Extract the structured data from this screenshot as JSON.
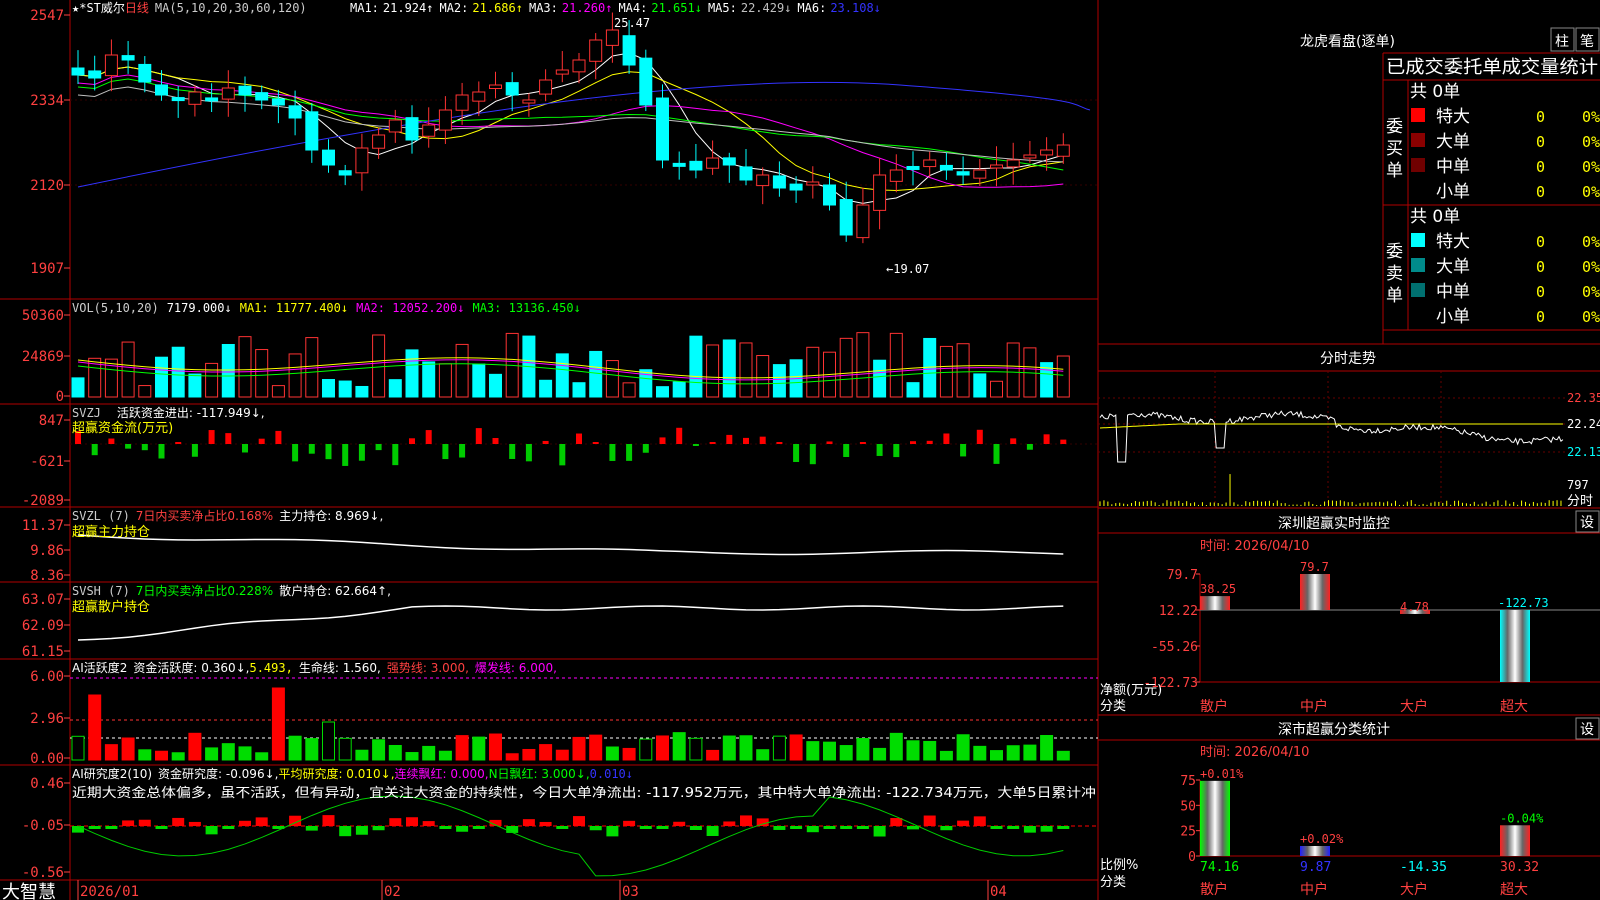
{
  "brand": "大智慧",
  "main_panel": {
    "stock_name": "★*ST威尔",
    "period": "日线",
    "ma_header": "MA(5,10,20,30,60,120)",
    "ma_values": [
      {
        "label": "MA1:",
        "value": "21.924↑",
        "color": "#ffffff"
      },
      {
        "label": "MA2:",
        "value": "21.686↑",
        "color": "#ffff00"
      },
      {
        "label": "MA3:",
        "value": "21.260↑",
        "color": "#ff00ff"
      },
      {
        "label": "MA4:",
        "value": "21.651↓",
        "color": "#00ff00"
      },
      {
        "label": "MA5:",
        "value": "22.429↓",
        "color": "#c0c0c0"
      },
      {
        "label": "MA6:",
        "value": "23.108↓",
        "color": "#3333ff"
      }
    ],
    "y_ticks": [
      "2547",
      "2334",
      "2120",
      "1907"
    ],
    "high_label": "25.47",
    "low_label": "←19.07"
  },
  "vol_panel": {
    "header": "VOL(5,10,20)",
    "value": "7179.000↓",
    "ma1": "MA1: 11777.400↓",
    "ma2": "MA2: 12052.200↓",
    "ma3": "MA3: 13136.450↓",
    "y_ticks": [
      "50360",
      "24869",
      "0"
    ]
  },
  "svzj_panel": {
    "header": "SVZJ",
    "line1": "活跃资金进出: -117.949↓,",
    "line2": "超赢资金流(万元)",
    "y_ticks": [
      "847",
      "-621",
      "-2089"
    ]
  },
  "svzl_panel": {
    "header": "SVZL (7)",
    "ratio": "7日内买卖净占比0.168%",
    "holding": "主力持仓: 8.969↓,",
    "line2": "超赢主力持仓",
    "y_ticks": [
      "11.37",
      "9.86",
      "8.36"
    ]
  },
  "svsh_panel": {
    "header": "SVSH (7)",
    "ratio": "7日内买卖净占比0.228%",
    "holding": "散户持仓: 62.664↑,",
    "line2": "超赢散户持仓",
    "y_ticks": [
      "63.07",
      "62.09",
      "61.15"
    ]
  },
  "ai_active_panel": {
    "header": "AI活跃度2",
    "activity": "资金活跃度: 0.360↓,",
    "value2": "5.493,",
    "life": "生命线: 1.560,",
    "strong": "强势线: 3.000,",
    "burst": "爆发线: 6.000,",
    "y_ticks": [
      "6.00",
      "2.96",
      "0.00"
    ]
  },
  "ai_research_panel": {
    "header": "AI研究度2(10)",
    "research": "资金研究度: -0.096↓,",
    "avg": "平均研究度: 0.010↓,",
    "red": "连续飘红: 0.000,",
    "nred": "N日飘红: 3.000↓,",
    "last": "0.010↓",
    "comment": "近期大资金总体偏多，虽不活跃，但有异动，宜关注大资金的持续性，今日大单净流出: -117.952万元，其中特大单净流出: -122.734万元，大单5日累计冲",
    "y_ticks": [
      "0.46",
      "-0.05",
      "-0.56"
    ]
  },
  "date_axis": [
    "2026/01",
    "02",
    "03",
    "04"
  ],
  "dragon_tiger": {
    "title": "龙虎看盘(逐单)",
    "btn1": "柱",
    "btn2": "笔",
    "subtitle": "已成交委托单成交量统计",
    "buy_side": {
      "side_label": "委买单",
      "total": "共 0单",
      "rows": [
        {
          "name": "特大",
          "count": "0",
          "pct": "0%",
          "color": "#ff0000"
        },
        {
          "name": "大单",
          "count": "0",
          "pct": "0%",
          "color": "#8b0000"
        },
        {
          "name": "中单",
          "count": "0",
          "pct": "0%",
          "color": "#700000"
        },
        {
          "name": "小单",
          "count": "0",
          "pct": "0%",
          "color": ""
        }
      ]
    },
    "sell_side": {
      "side_label": "委卖单",
      "total": "共 0单",
      "rows": [
        {
          "name": "特大",
          "count": "0",
          "pct": "0%",
          "color": "#00ffff"
        },
        {
          "name": "大单",
          "count": "0",
          "pct": "0%",
          "color": "#008b8b"
        },
        {
          "name": "中单",
          "count": "0",
          "pct": "0%",
          "color": "#007070"
        },
        {
          "name": "小单",
          "count": "0",
          "pct": "0%",
          "color": ""
        }
      ]
    }
  },
  "intraday": {
    "title": "分时走势",
    "y_labels": [
      "22.35",
      "22.24",
      "22.13"
    ],
    "vol_label": "797",
    "vol_unit": "分时"
  },
  "sz_monitor": {
    "title": "深圳超赢实时监控",
    "settings": "设",
    "time": "时间: 2026/04/10",
    "y_ticks": [
      "79.7",
      "12.22",
      "-55.26",
      "-122.73"
    ],
    "y_label": "净额(万元)",
    "x_label": "分类",
    "categories": [
      "散户",
      "中户",
      "大户",
      "超大"
    ],
    "values": [
      38.25,
      79.7,
      4.78,
      -122.73
    ],
    "value_labels": [
      "38.25",
      "79.7",
      "4.78",
      "-122.73"
    ]
  },
  "sz_class": {
    "title": "深市超赢分类统计",
    "settings": "设",
    "time": "时间: 2026/04/10",
    "y_ticks": [
      "75",
      "50",
      "25",
      "0"
    ],
    "y_label": "比例%",
    "x_label": "分类",
    "categories": [
      "散户",
      "中户",
      "大户",
      "超大"
    ],
    "values": [
      74.16,
      9.87,
      -14.35,
      30.32
    ],
    "value_labels": [
      "74.16",
      "9.87",
      "-14.35",
      "30.32"
    ],
    "change_labels": [
      "+0.01%",
      "+0.02%",
      "",
      "-0.04%"
    ]
  },
  "colors": {
    "up": "#ff3333",
    "down": "#00ffff",
    "frame": "#b00000",
    "axis_text": "#ff4040"
  }
}
